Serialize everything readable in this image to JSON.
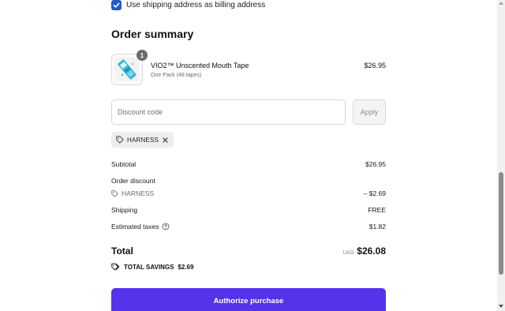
{
  "billing": {
    "checked": true,
    "label": "Use shipping address as billing address"
  },
  "summary": {
    "title": "Order summary"
  },
  "product": {
    "quantity": "1",
    "name": "VIO2™ Unscented Mouth Tape",
    "variant": "One Pack (48 tapes)",
    "price": "$26.95",
    "image_icon": "product-image"
  },
  "discount": {
    "placeholder": "Discount code",
    "value": "",
    "apply_label": "Apply",
    "applied_code": "HARNESS"
  },
  "totals": {
    "subtotal_label": "Subtotal",
    "subtotal_value": "$26.95",
    "order_discount_label": "Order discount",
    "discount_code": "HARNESS",
    "discount_value": "– $2.69",
    "shipping_label": "Shipping",
    "shipping_value": "FREE",
    "taxes_label": "Estimated taxes",
    "taxes_value": "$1.82",
    "total_label": "Total",
    "currency": "USD",
    "total_value": "$26.08",
    "savings_label": "TOTAL SAVINGS",
    "savings_value": "$2.69"
  },
  "actions": {
    "authorize_label": "Authorize purchase"
  },
  "colors": {
    "accent": "#5433eb",
    "checkbox": "#1f5ac8"
  }
}
